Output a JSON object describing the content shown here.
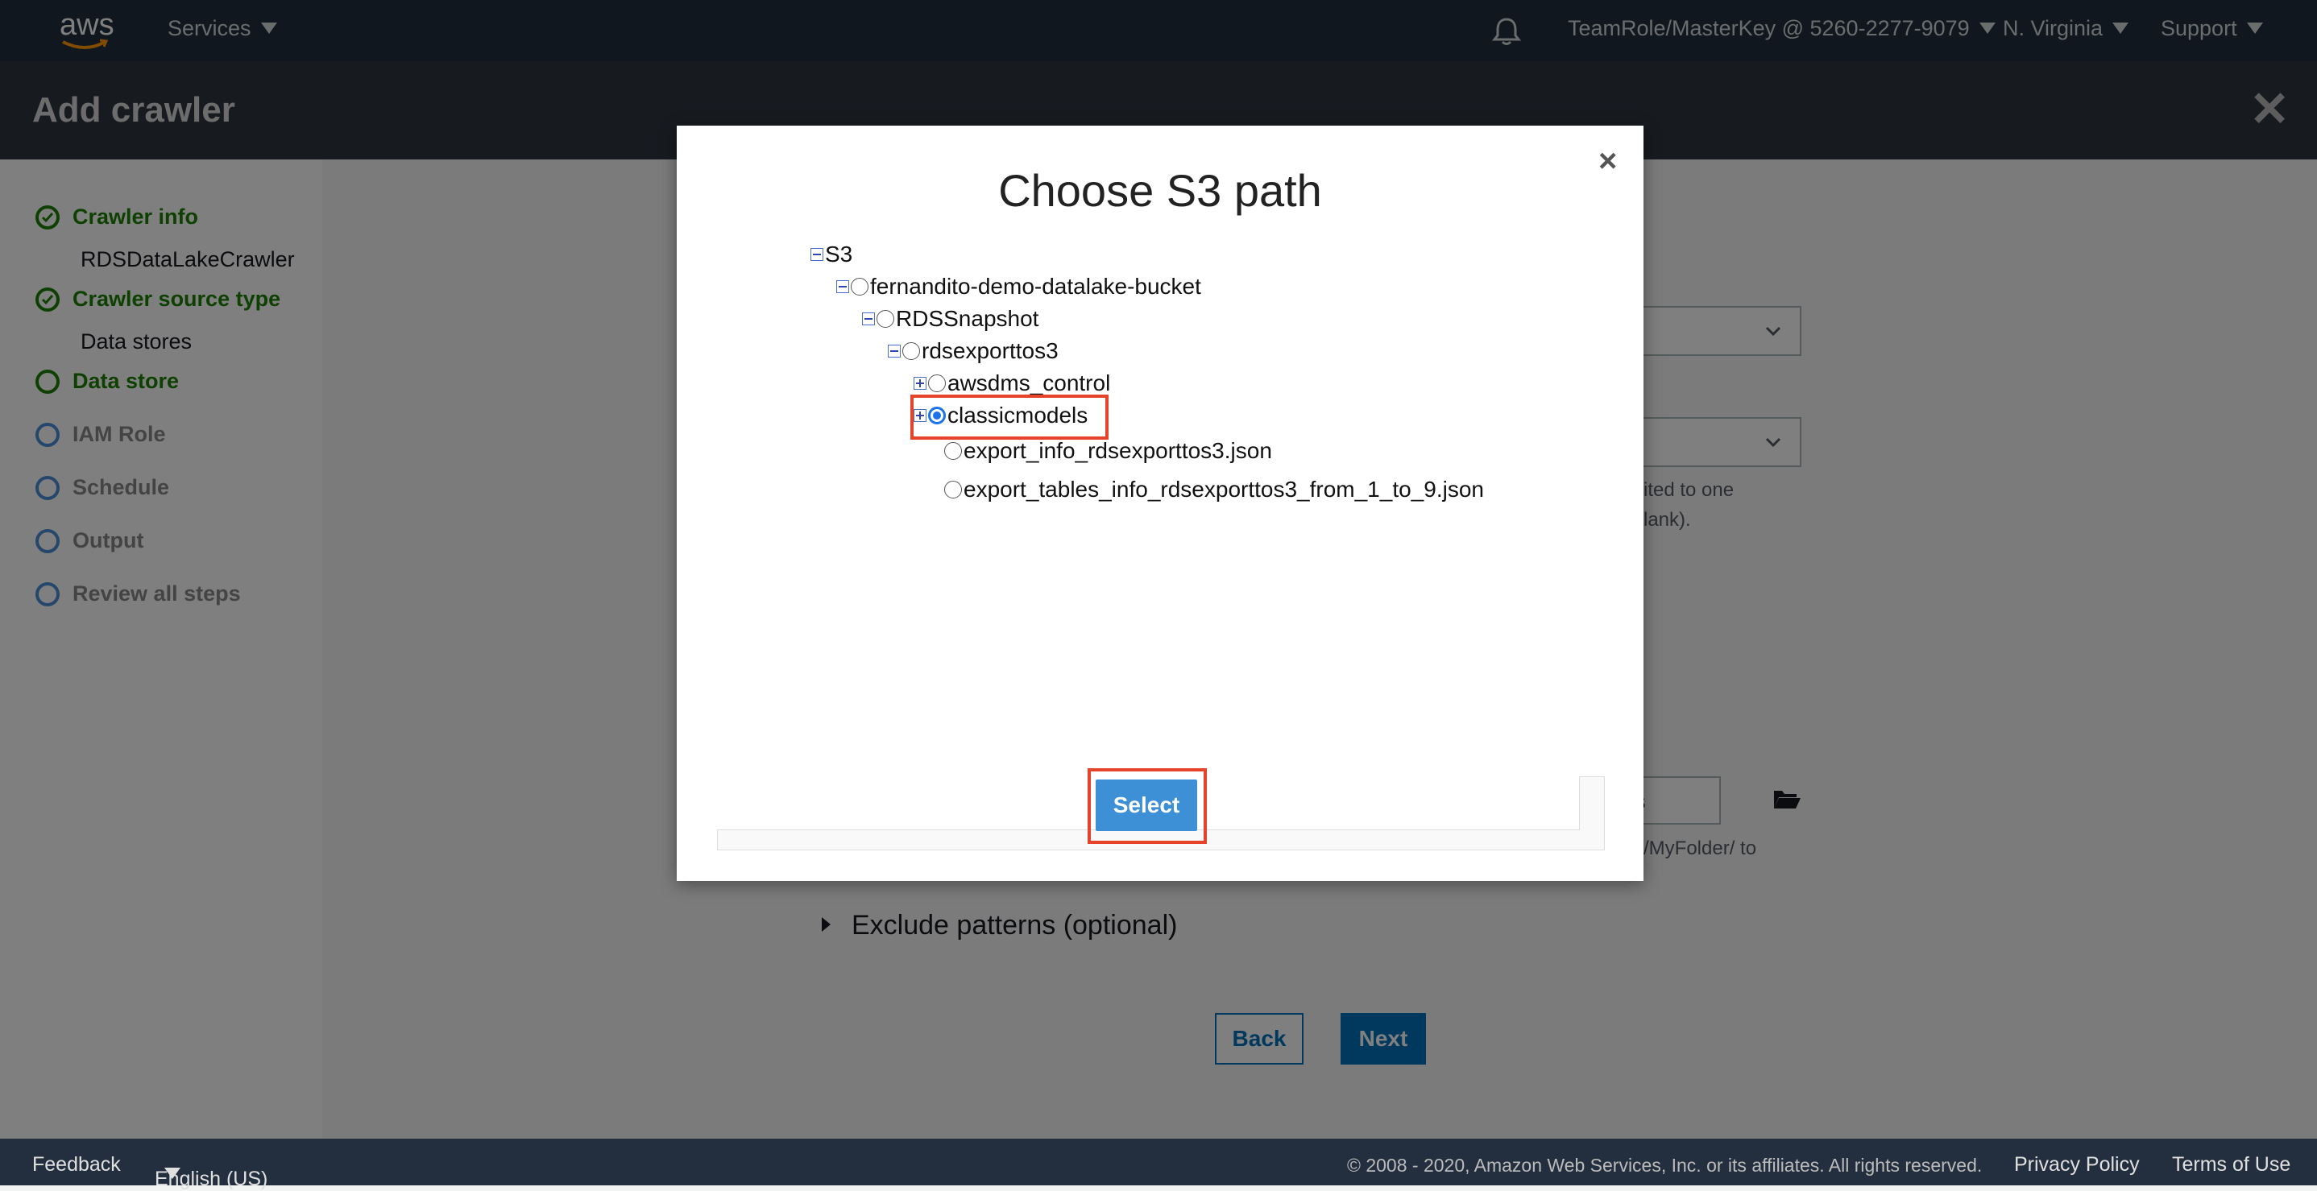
{
  "topnav": {
    "logo_text": "aws",
    "services_label": "Services",
    "account_label": "TeamRole/MasterKey @ 5260-2277-9079",
    "region_label": "N. Virginia",
    "support_label": "Support"
  },
  "header": {
    "title": "Add crawler"
  },
  "sidebar": {
    "steps": [
      {
        "label": "Crawler info",
        "sub": "RDSDataLakeCrawler",
        "state": "done"
      },
      {
        "label": "Crawler source type",
        "sub": "Data stores",
        "state": "done"
      },
      {
        "label": "Data store",
        "state": "current"
      },
      {
        "label": "IAM Role",
        "state": "todo"
      },
      {
        "label": "Schedule",
        "state": "todo"
      },
      {
        "label": "Output",
        "state": "todo"
      },
      {
        "label": "Review all steps",
        "state": "todo"
      }
    ]
  },
  "main": {
    "help_limit": "ited to one",
    "help_blank": "lank).",
    "include_path_value": "els",
    "include_help": "/MyFolder/ to",
    "exclude_label": "Exclude patterns (optional)",
    "back_label": "Back",
    "next_label": "Next"
  },
  "modal": {
    "title": "Choose S3 path",
    "close_glyph": "×",
    "tree": {
      "root": "S3",
      "bucket": "fernandito-demo-datalake-bucket",
      "snapshot": "RDSSnapshot",
      "export": "rdsexporttos3",
      "children": [
        {
          "label": "awsdms_control"
        },
        {
          "label": "classicmodels",
          "selected": true
        },
        {
          "label": "export_info_rdsexporttos3.json"
        },
        {
          "label": "export_tables_info_rdsexporttos3_from_1_to_9.json"
        }
      ]
    },
    "select_label": "Select"
  },
  "footer": {
    "feedback": "Feedback",
    "language": "English (US)",
    "copyright": "© 2008 - 2020, Amazon Web Services, Inc. or its affiliates. All rights reserved.",
    "privacy": "Privacy Policy",
    "terms": "Terms of Use"
  },
  "colors": {
    "nav_bg": "#232f3e",
    "success_green": "#1d8102",
    "primary_blue": "#0073bb",
    "highlight_red": "#e5432a"
  }
}
